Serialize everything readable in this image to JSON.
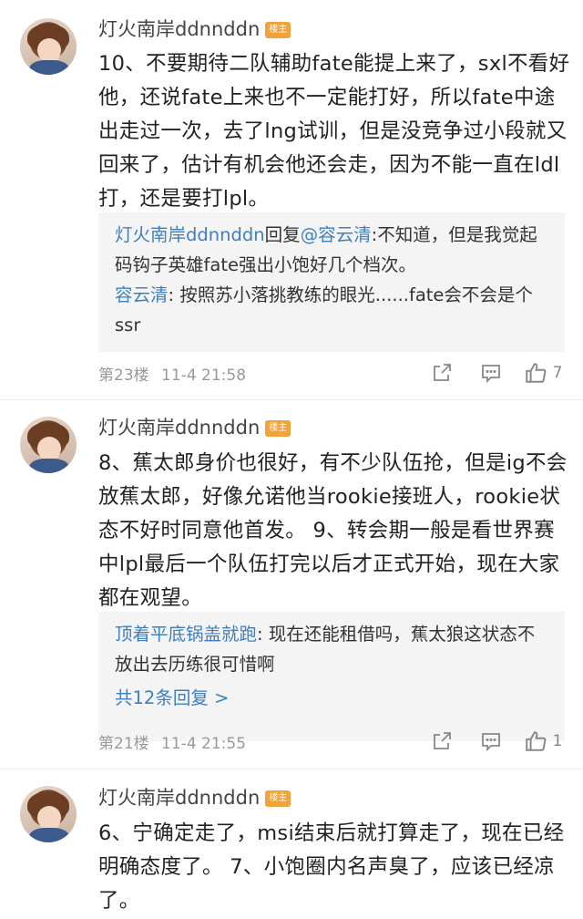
{
  "posts": [
    {
      "username": "灯火南岸ddnnddn",
      "badge": "楼主",
      "content": "10、不要期待二队辅助fate能提上来了，sxl不看好他，还说fate上来也不一定能打好，所以fate中途出走过一次，去了lng试训，但是没竞争过小段就又回来了，估计有机会他还会走，因为不能一直在ldl打，还是要打lpl。",
      "replies": [
        {
          "name": "灯火南岸ddnnddn",
          "mid": "回复",
          "target": "@容云清",
          "text": ":不知道，但是我觉起码钩子英雄fate强出小饱好几个档次。"
        },
        {
          "name": "容云清",
          "mid": "",
          "target": "",
          "text": ": 按照苏小落挑教练的眼光......fate会不会是个ssr"
        }
      ],
      "more": "",
      "floor": "第23楼",
      "time": "11-4  21:58",
      "likes": "7"
    },
    {
      "username": "灯火南岸ddnnddn",
      "badge": "楼主",
      "content": "8、蕉太郎身价也很好，有不少队伍抢，但是ig不会放蕉太郎，好像允诺他当rookie接班人，rookie状态不好时同意他首发。  9、转会期一般是看世界赛中lpl最后一个队伍打完以后才正式开始，现在大家都在观望。",
      "replies": [
        {
          "name": "顶着平底锅盖就跑",
          "mid": "",
          "target": "",
          "text": ": 现在还能租借吗，蕉太狼这状态不放出去历练很可惜啊"
        }
      ],
      "more": "共12条回复 >",
      "floor": "第21楼",
      "time": "11-4  21:55",
      "likes": "1"
    },
    {
      "username": "灯火南岸ddnnddn",
      "badge": "楼主",
      "content": "6、宁确定走了，msi结束后就打算走了，现在已经明确态度了。 7、小饱圈内名声臭了，应该已经凉了。"
    }
  ],
  "icons": {
    "share": "share-icon",
    "comment": "comment-icon",
    "like": "thumbs-up-icon"
  },
  "colors": {
    "link": "#3f7fbf",
    "badge": "#f2a23a",
    "reply_bg": "#f4f4f4"
  }
}
